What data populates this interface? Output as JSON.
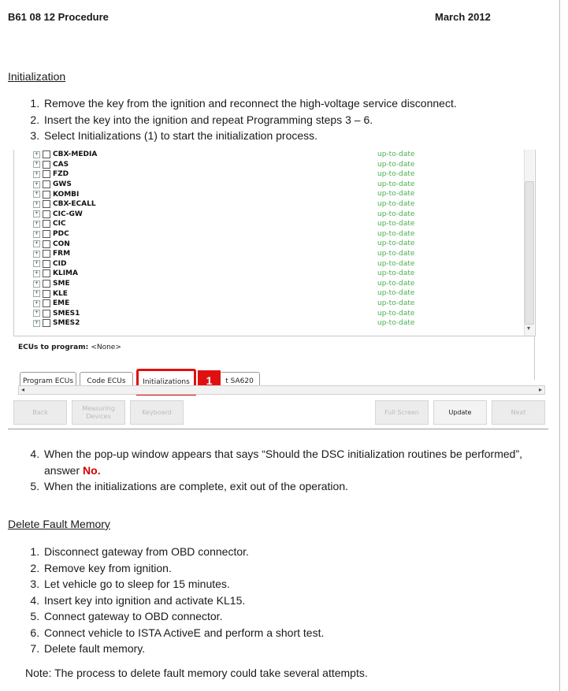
{
  "header": {
    "procedure": "B61 08 12 Procedure",
    "date": "March 2012"
  },
  "initialization": {
    "title": "Initialization",
    "steps": [
      "Remove the key from the ignition and reconnect the high-voltage service disconnect.",
      "Insert the key into the ignition and repeat Programming steps 3 – 6.",
      "Select Initializations (1) to start the initialization process."
    ]
  },
  "screenshot": {
    "ecus": [
      "CBX-MEDIA",
      "CAS",
      "FZD",
      "GWS",
      "KOMBI",
      "CBX-ECALL",
      "CIC-GW",
      "CIC",
      "PDC",
      "CON",
      "FRM",
      "CID",
      "KLIMA",
      "SME",
      "KLE",
      "EME",
      "SMES1",
      "SMES2"
    ],
    "status": "up-to-date",
    "ecus_to_program_label": "ECUs to program:",
    "ecus_to_program_value": "<None>",
    "tabs": {
      "program": "Program ECUs",
      "code": "Code ECUs",
      "init": "Initializations",
      "partial": "t SA620"
    },
    "callout": "1",
    "buttons": {
      "back": "Back",
      "measuring": "Measuring Devices",
      "keyboard": "Keyboard",
      "fullscreen": "Full Screen",
      "update": "Update",
      "next": "Next"
    }
  },
  "after": {
    "step4_pre": "When the pop-up window appears that says “Should the DSC initialization routines be performed”, answer ",
    "step4_answer": "No.",
    "step5": "When the initializations are complete, exit out of the operation."
  },
  "fault": {
    "title": "Delete Fault Memory",
    "steps": [
      "Disconnect gateway from OBD connector.",
      "Remove key from ignition.",
      "Let vehicle go to sleep for 15 minutes.",
      "Insert key into ignition and activate KL15.",
      "Connect gateway to OBD connector.",
      "Connect vehicle to ISTA ActiveE and perform a short test.",
      "Delete fault memory."
    ],
    "note": "Note: The process to delete fault memory could take several attempts."
  },
  "colors": {
    "accent_red": "#e01010",
    "status_green": "#4caf50"
  }
}
